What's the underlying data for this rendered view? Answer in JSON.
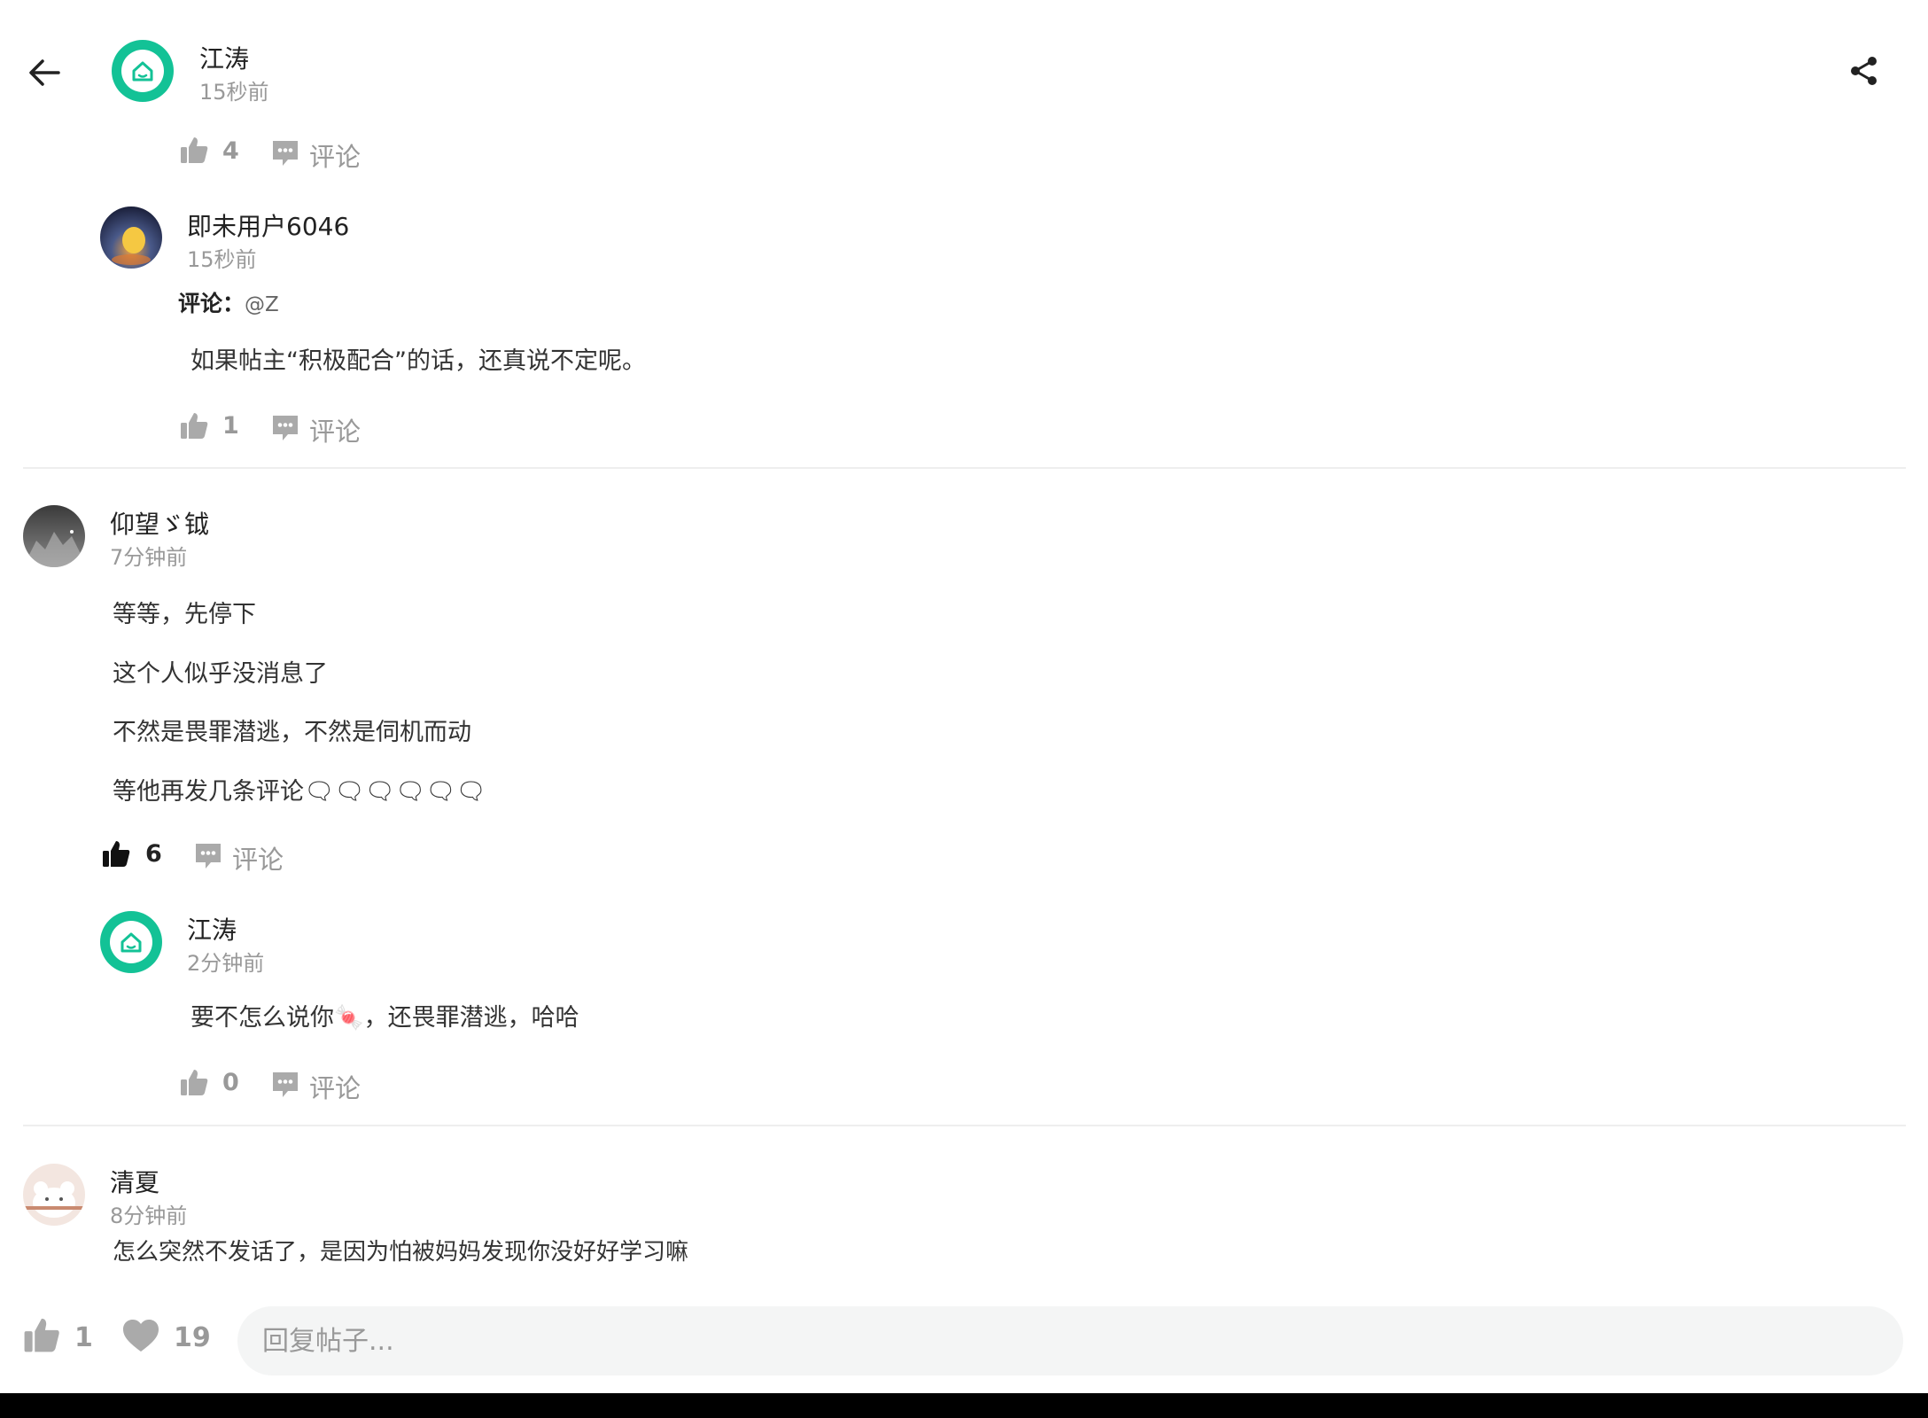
{
  "header": {
    "author_name": "江涛",
    "author_time": "15秒前"
  },
  "thread1": {
    "like_count": "4",
    "comment_label": "评论",
    "reply": {
      "name": "即未用户6046",
      "time": "15秒前",
      "reply_prefix": "评论：",
      "reply_target": "@Z",
      "text": "如果帖主“积极配合”的话，还真说不定呢。",
      "like_count": "1",
      "comment_label": "评论"
    }
  },
  "comment2": {
    "name": "仰望ゞ钺",
    "time": "7分钟前",
    "lines": [
      "等等，先停下",
      "这个人似乎没消息了",
      "不然是畏罪潜逃，不然是伺机而动",
      "等他再发几条评论🗨🗨🗨🗨🗨🗨"
    ],
    "like_count": "6",
    "comment_label": "评论",
    "reply": {
      "name": "江涛",
      "time": "2分钟前",
      "text": "要不怎么说你🍬，还畏罪潜逃，哈哈",
      "like_count": "0",
      "comment_label": "评论"
    }
  },
  "comment3": {
    "name": "清夏",
    "time": "8分钟前",
    "text": "怎么突然不发话了，是因为怕被妈妈发现你没好好学习嘛"
  },
  "bottom_bar": {
    "like_count": "1",
    "favorite_count": "19",
    "reply_placeholder": "回复帖子..."
  },
  "colors": {
    "brand_green": "#13c296",
    "muted_text": "#999999",
    "divider": "#eeeeee",
    "input_bg": "#f4f5f5"
  },
  "icons": {
    "back": "arrow-left-icon",
    "share": "share-icon",
    "like": "thumbs-up-icon",
    "comment": "comment-bubble-icon",
    "favorite": "heart-icon",
    "avatar_home": "home-icon"
  }
}
